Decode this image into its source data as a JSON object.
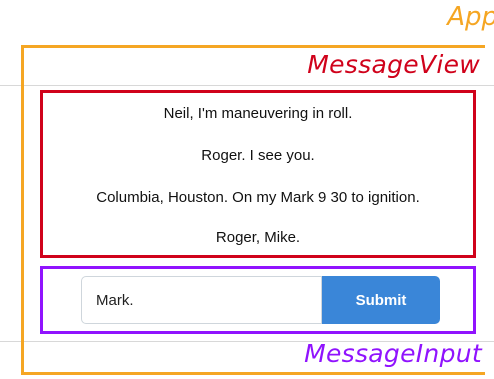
{
  "labels": {
    "app": "App",
    "message_view": "MessageView",
    "message_input": "MessageInput"
  },
  "messages": [
    "Neil, I'm maneuvering in roll.",
    "Roger. I see you.",
    "Columbia, Houston. On my Mark 9 30 to ignition.",
    "Roger, Mike."
  ],
  "input": {
    "value": "Mark.",
    "submit_label": "Submit"
  },
  "colors": {
    "app": "#f5a623",
    "message_view": "#d0021b",
    "message_input": "#9013fe",
    "submit_button": "#3a86d8"
  }
}
